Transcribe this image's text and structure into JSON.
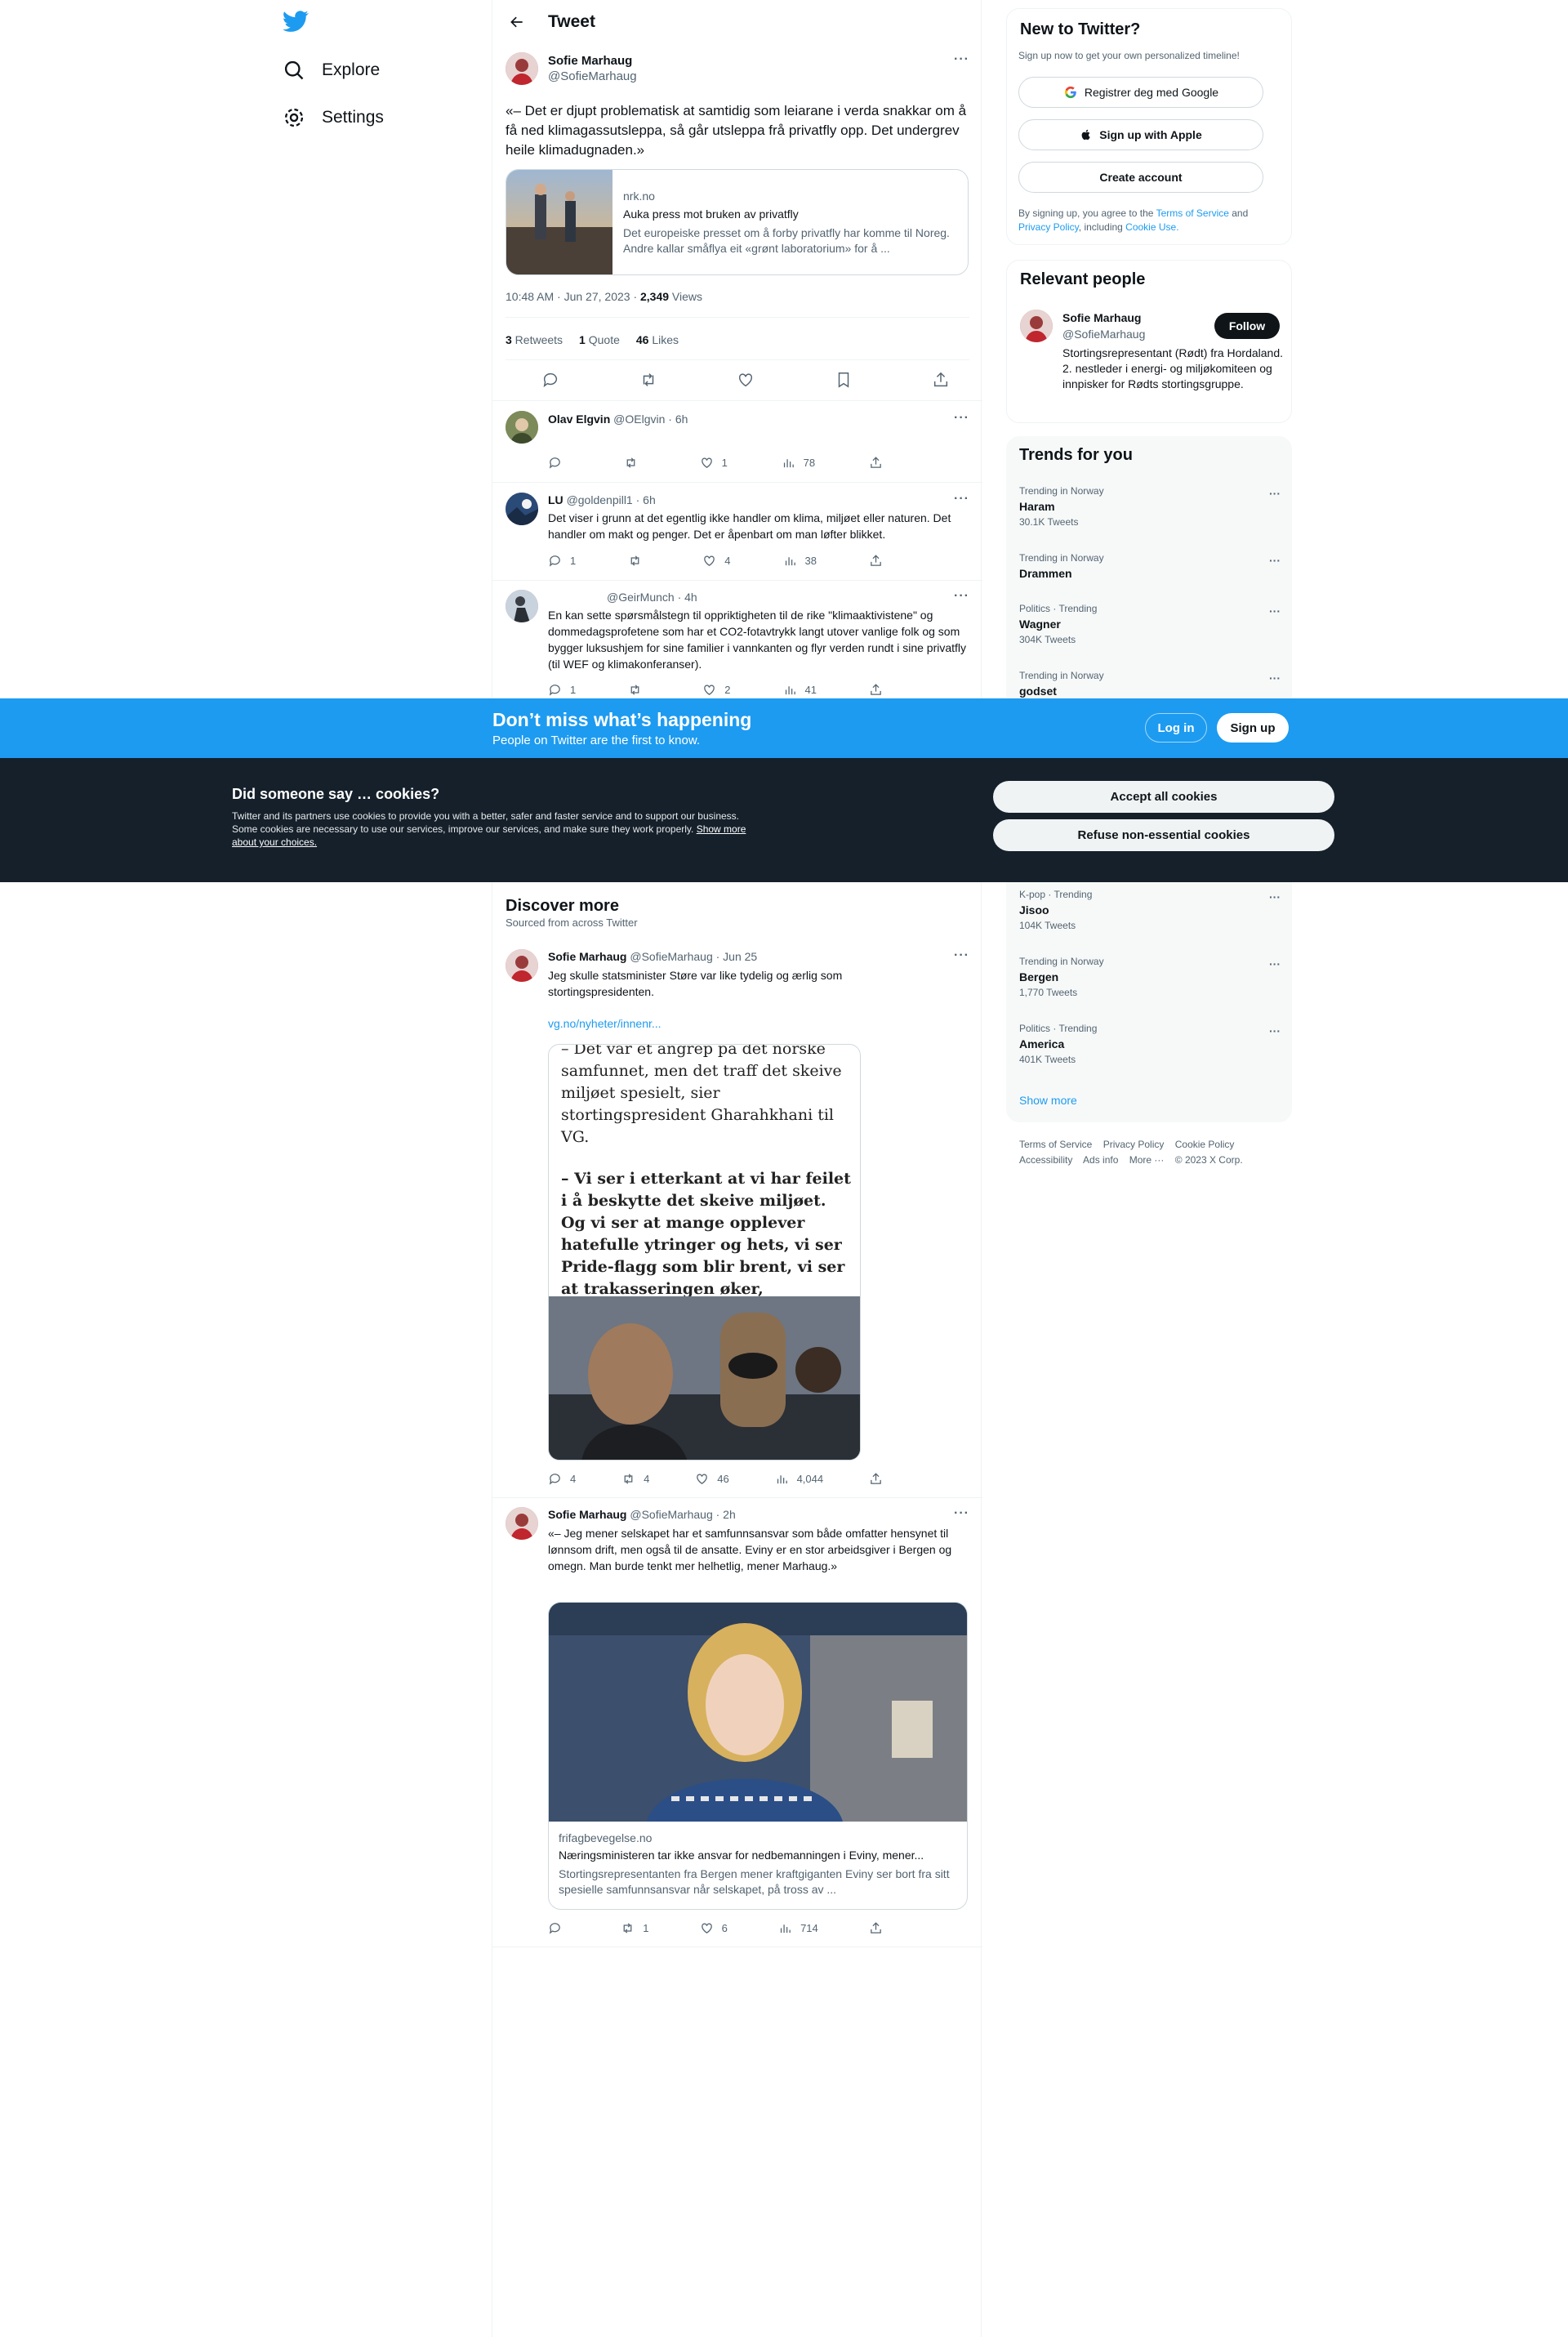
{
  "nav": {
    "items": [
      {
        "label": "Explore",
        "icon": "search-icon"
      },
      {
        "label": "Settings",
        "icon": "gear-icon"
      }
    ]
  },
  "header": {
    "title": "Tweet"
  },
  "main_tweet": {
    "author": "Sofie Marhaug",
    "handle": "@SofieMarhaug",
    "text": "«– Det er djupt problematisk at samtidig som leiarane i verda snakkar om å få ned klimagassutsleppa, så går utsleppa frå privatfly opp. Det undergrev heile klimadugnaden.»",
    "card": {
      "domain": "nrk.no",
      "title": "Auka press mot bruken av privatfly",
      "desc": "Det europeiske presset om å forby privatfly har komme til Noreg. Andre kallar småflya eit «grønt laboratorium» for å ..."
    },
    "time": "10:48 AM · Jun 27, 2023 · ",
    "views_count": "2,349",
    "views_label": " Views",
    "retweets_count": "3",
    "retweets_label": " Retweets",
    "quotes_count": "1",
    "quotes_label": " Quote",
    "likes_count": "46",
    "likes_label": " Likes"
  },
  "replies": [
    {
      "name": "Olav Elgvin",
      "handle": "@OElgvin · 6h",
      "text": "",
      "replies": "",
      "retweets": "",
      "likes": "1",
      "views": "78"
    },
    {
      "name": "LU",
      "handle": "@goldenpill1 · 6h",
      "text": "Det viser i grunn at det egentlig ikke handler om klima, miljøet eller naturen. Det handler om makt og penger. Det er åpenbart om man løfter blikket.",
      "replies": "1",
      "retweets": "",
      "likes": "4",
      "views": "38"
    },
    {
      "name": "",
      "handle": "@GeirMunch · 4h",
      "text": "En kan sette spørsmålstegn til oppriktigheten til de rike \"klimaaktivistene\" og dommedagsprofetene som har et CO2-fotavtrykk langt utover vanlige folk og som bygger luksushjem for sine familier i vannkanten og flyr verden rundt i sine privatfly (til WEF og klimakonferanser).",
      "replies": "1",
      "retweets": "",
      "likes": "2",
      "views": "41"
    }
  ],
  "discover": {
    "title": "Discover more",
    "subtitle": "Sourced from across Twitter",
    "tweets": [
      {
        "name": "Sofie Marhaug",
        "handle": "@SofieMarhaug · Jun 25",
        "text": "Jeg skulle statsminister Støre var like tydelig og ærlig som stortingspresidenten.",
        "link": "vg.no/nyheter/innenr...",
        "article_lines": [
          "– Det var et angrep på det norske samfunnet, men det traff det skeive miljøet spesielt, sier stortingspresident Gharahkhani til VG.",
          "– Vi ser i etterkant at vi har feilet i å beskytte det skeive miljøet. Og vi ser at mange opplever hatefulle ytringer og hets, vi ser Pride-flagg som blir brent, vi ser at trakasseringen øker, fortsetter han."
        ],
        "replies": "4",
        "retweets": "4",
        "likes": "46",
        "views": "4,044"
      },
      {
        "name": "Sofie Marhaug",
        "handle": "@SofieMarhaug · 2h",
        "text": "«– Jeg mener selskapet har et samfunnsansvar som både omfatter hensynet til lønnsom drift, men også til de ansatte. Eviny er en stor arbeidsgiver i Bergen og omegn. Man burde tenkt mer helhetlig, mener Marhaug.»",
        "card": {
          "domain": "frifagbevegelse.no",
          "title": "Næringsministeren tar ikke ansvar for nedbemanningen i Eviny, mener...",
          "desc": "Stortingsrepresentanten fra Bergen mener kraftgiganten Eviny ser bort fra sitt spesielle samfunnsansvar når selskapet, på tross av ..."
        },
        "replies": "",
        "retweets": "1",
        "likes": "6",
        "views": "714"
      }
    ]
  },
  "signup": {
    "title": "New to Twitter?",
    "subtitle": "Sign up now to get your own personalized timeline!",
    "google": "Registrer deg med Google",
    "apple": "Sign up with Apple",
    "create": "Create account",
    "legal_pre": "By signing up, you agree to the ",
    "tos": "Terms of Service",
    "and": " and ",
    "privacy": "Privacy Policy",
    "incl": ", including ",
    "cookie": "Cookie Use."
  },
  "relevant": {
    "title": "Relevant people",
    "name": "Sofie Marhaug",
    "handle": "@SofieMarhaug",
    "follow": "Follow",
    "bio": "Stortingsrepresentant (Rødt) fra Hordaland. 2. nestleder i energi- og miljøkomiteen og innpisker for Rødts stortingsgruppe."
  },
  "trends": {
    "title": "Trends for you",
    "items": [
      {
        "cat": "Trending in Norway",
        "name": "Haram",
        "count": "30.1K Tweets"
      },
      {
        "cat": "Trending in Norway",
        "name": "Drammen",
        "count": ""
      },
      {
        "cat": "Politics · Trending",
        "name": "Wagner",
        "count": "304K Tweets"
      },
      {
        "cat": "Trending in Norway",
        "name": "godset",
        "count": ""
      },
      {
        "cat": "K-pop · Trending",
        "name": "Jisoo",
        "count": "104K Tweets"
      },
      {
        "cat": "Trending in Norway",
        "name": "Bergen",
        "count": "1,770 Tweets"
      },
      {
        "cat": "Politics · Trending",
        "name": "America",
        "count": "401K Tweets"
      }
    ],
    "show_more": "Show more"
  },
  "footer": {
    "links": [
      "Terms of Service",
      "Privacy Policy",
      "Cookie Policy",
      "Accessibility",
      "Ads info",
      "More ···"
    ],
    "copyright": "© 2023 X Corp."
  },
  "banner": {
    "title": "Don’t miss what’s happening",
    "subtitle": "People on Twitter are the first to know.",
    "login": "Log in",
    "signup": "Sign up"
  },
  "cookies": {
    "title": "Did someone say … cookies?",
    "body": "Twitter and its partners use cookies to provide you with a better, safer and faster service and to support our business. Some cookies are necessary to use our services, improve our services, and make sure they work properly. ",
    "link": "Show more about your choices.",
    "accept": "Accept all cookies",
    "refuse": "Refuse non-essential cookies"
  },
  "colors": {
    "accent": "#1d9bf0",
    "dark": "#15202b",
    "muted": "#536471",
    "border": "#eff3f4"
  }
}
